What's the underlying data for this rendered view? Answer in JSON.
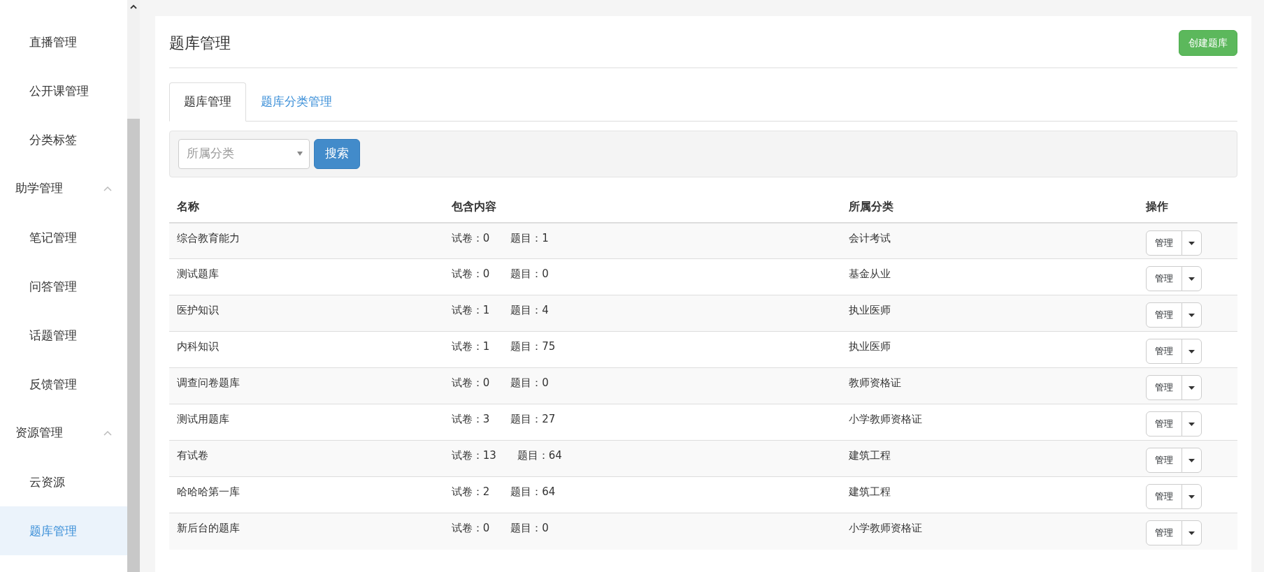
{
  "sidebar": {
    "sections": [
      {
        "children": [
          {
            "label": "直播管理",
            "selected": false
          },
          {
            "label": "公开课管理",
            "selected": false
          },
          {
            "label": "分类标签",
            "selected": false
          }
        ]
      },
      {
        "label": "助学管理",
        "expanded": true,
        "children": [
          {
            "label": "笔记管理",
            "selected": false
          },
          {
            "label": "问答管理",
            "selected": false
          },
          {
            "label": "话题管理",
            "selected": false
          },
          {
            "label": "反馈管理",
            "selected": false
          }
        ]
      },
      {
        "label": "资源管理",
        "expanded": true,
        "children": [
          {
            "label": "云资源",
            "selected": false
          },
          {
            "label": "题库管理",
            "selected": true
          }
        ]
      }
    ]
  },
  "page": {
    "title": "题库管理",
    "create_button": "创建题库"
  },
  "tabs": [
    {
      "label": "题库管理",
      "selected": true
    },
    {
      "label": "题库分类管理",
      "selected": false
    }
  ],
  "filter": {
    "category_placeholder": "所属分类",
    "search_button": "搜索"
  },
  "table": {
    "columns": [
      "名称",
      "包含内容",
      "所属分类",
      "操作"
    ],
    "rows": [
      {
        "name": "综合教育能力",
        "papers": "试卷：0",
        "questions": "题目：1",
        "category": "会计考试",
        "action": "管理"
      },
      {
        "name": "测试题库",
        "papers": "试卷：0",
        "questions": "题目：0",
        "category": "基金从业",
        "action": "管理"
      },
      {
        "name": "医护知识",
        "papers": "试卷：1",
        "questions": "题目：4",
        "category": "执业医师",
        "action": "管理"
      },
      {
        "name": "内科知识",
        "papers": "试卷：1",
        "questions": "题目：75",
        "category": "执业医师",
        "action": "管理"
      },
      {
        "name": "调查问卷题库",
        "papers": "试卷：0",
        "questions": "题目：0",
        "category": "教师资格证",
        "action": "管理"
      },
      {
        "name": "测试用题库",
        "papers": "试卷：3",
        "questions": "题目：27",
        "category": "小学教师资格证",
        "action": "管理"
      },
      {
        "name": "有试卷",
        "papers": "试卷：13",
        "questions": "题目：64",
        "category": "建筑工程",
        "action": "管理"
      },
      {
        "name": "哈哈哈第一库",
        "papers": "试卷：2",
        "questions": "题目：64",
        "category": "建筑工程",
        "action": "管理"
      },
      {
        "name": "新后台的题库",
        "papers": "试卷：0",
        "questions": "题目：0",
        "category": "小学教师资格证",
        "action": "管理"
      }
    ]
  }
}
